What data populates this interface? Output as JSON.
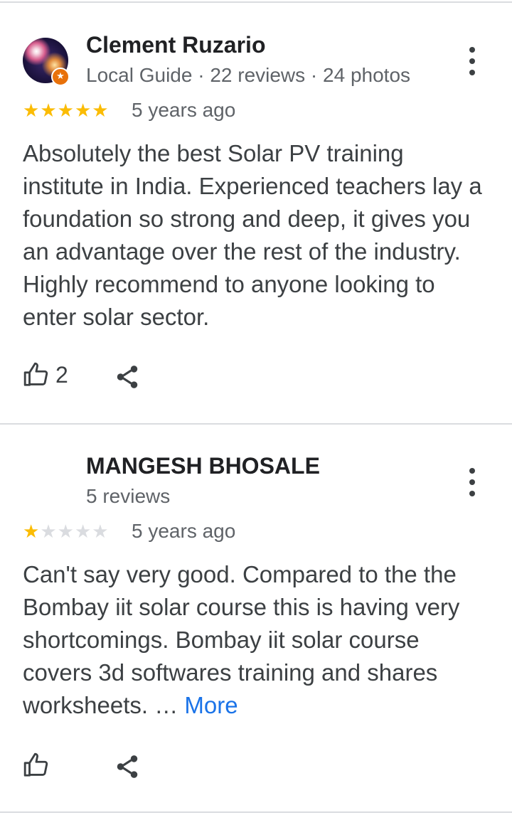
{
  "reviews": [
    {
      "name": "Clement Ruzario",
      "meta": "Local Guide · 22 reviews · 24 photos",
      "badge_icon": "star-badge-icon",
      "rating": 5,
      "time": "5 years ago",
      "text": "Absolutely the best Solar PV training institute in India. Experienced teachers lay a foundation so strong and deep, it gives you an advantage over the rest of the industry. Highly recommend to anyone looking to enter solar sector.",
      "likes": "2"
    },
    {
      "name": "MANGESH BHOSALE",
      "meta": "5 reviews",
      "rating": 1,
      "time": "5 years ago",
      "text": "Can't say very good. Compared to the the Bombay iit solar course this is having very shortcomings. Bombay iit solar course covers 3d softwares training and shares worksheets. …",
      "more": "More",
      "likes": ""
    }
  ],
  "star_max": 5,
  "colors": {
    "star_on": "#fbbc04",
    "star_off": "#dadce0",
    "link": "#1a73e8",
    "badge": "#e8710a"
  },
  "icons": {
    "like": "thumbs-up-icon",
    "share": "share-icon",
    "menu": "more-vert-icon"
  }
}
